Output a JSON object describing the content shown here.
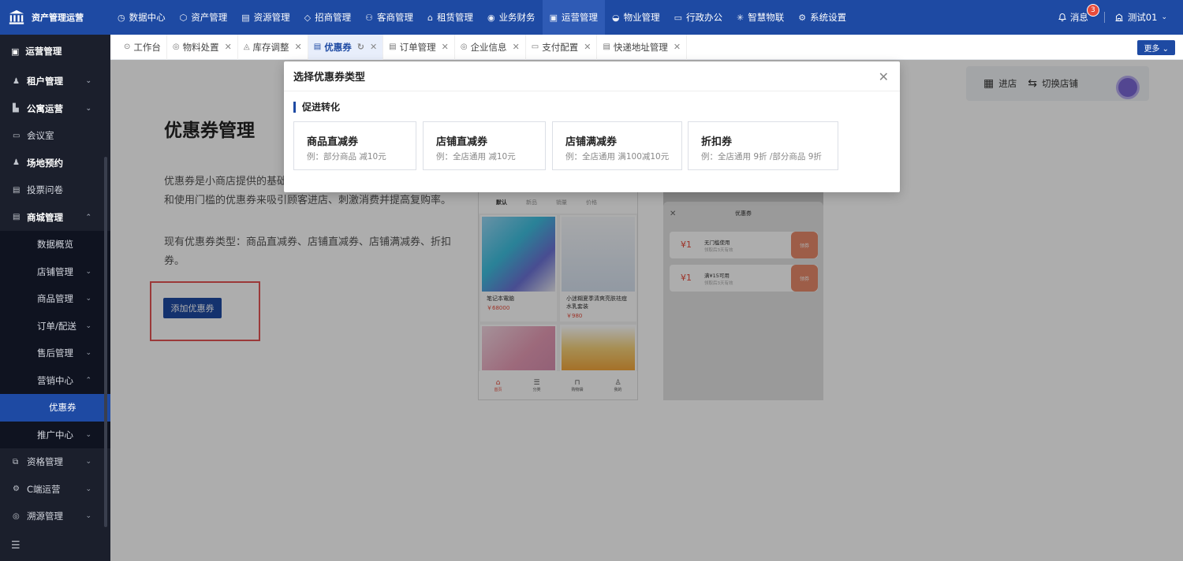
{
  "app": {
    "title": "资产管理运营"
  },
  "topnav": [
    {
      "label": "数据中心",
      "icon": "◷"
    },
    {
      "label": "资产管理",
      "icon": "⬡"
    },
    {
      "label": "资源管理",
      "icon": "▤"
    },
    {
      "label": "招商管理",
      "icon": "◇"
    },
    {
      "label": "客商管理",
      "icon": "⚇"
    },
    {
      "label": "租赁管理",
      "icon": "⌂"
    },
    {
      "label": "业务财务",
      "icon": "◉"
    },
    {
      "label": "运营管理",
      "icon": "▣",
      "active": true
    },
    {
      "label": "物业管理",
      "icon": "◒"
    },
    {
      "label": "行政办公",
      "icon": "▭"
    },
    {
      "label": "智慧物联",
      "icon": "✳"
    },
    {
      "label": "系统设置",
      "icon": "⚙"
    }
  ],
  "header_right": {
    "messages_label": "消息",
    "messages_count": "3",
    "user_name": "测试01"
  },
  "sidebar": {
    "title": "运营管理",
    "items": [
      {
        "label": "租户管理",
        "icon": "♟",
        "chevron": "⌄"
      },
      {
        "label": "公寓运营",
        "icon": "▙",
        "chevron": "⌄"
      },
      {
        "label": "会议室",
        "icon": "▭",
        "chevron": ""
      },
      {
        "label": "场地预约",
        "icon": "♟",
        "chevron": ""
      },
      {
        "label": "投票问卷",
        "icon": "▤",
        "chevron": ""
      },
      {
        "label": "商城管理",
        "icon": "▤",
        "chevron": "⌃"
      }
    ],
    "mall_sub": [
      {
        "label": "数据概览",
        "chevron": ""
      },
      {
        "label": "店铺管理",
        "chevron": "⌄"
      },
      {
        "label": "商品管理",
        "chevron": "⌄"
      },
      {
        "label": "订单/配送",
        "chevron": "⌄"
      },
      {
        "label": "售后管理",
        "chevron": "⌄"
      },
      {
        "label": "营销中心",
        "chevron": "⌃"
      }
    ],
    "marketing_sub": [
      {
        "label": "优惠券"
      }
    ],
    "after_sub": [
      {
        "label": "推广中心",
        "chevron": "⌄"
      }
    ],
    "bottom_items": [
      {
        "label": "资格管理",
        "icon": "⧉",
        "chevron": "⌄"
      },
      {
        "label": "C端运营",
        "icon": "⚙",
        "chevron": "⌄"
      },
      {
        "label": "溯源管理",
        "icon": "◎",
        "chevron": "⌄"
      }
    ]
  },
  "tabs": [
    {
      "label": "工作台",
      "icon": "⊙",
      "closable": false
    },
    {
      "label": "物料处置",
      "icon": "◎",
      "closable": true
    },
    {
      "label": "库存调整",
      "icon": "◬",
      "closable": true
    },
    {
      "label": "优惠券",
      "icon": "▤",
      "closable": true,
      "active": true
    },
    {
      "label": "订单管理",
      "icon": "▤",
      "closable": true
    },
    {
      "label": "企业信息",
      "icon": "◎",
      "closable": true
    },
    {
      "label": "支付配置",
      "icon": "▭",
      "closable": true
    },
    {
      "label": "快递地址管理",
      "icon": "▤",
      "closable": true
    }
  ],
  "more_label": "更多 ⌄",
  "corner": {
    "enter_store": "进店",
    "switch_store": "切换店铺"
  },
  "page": {
    "title": "优惠券管理",
    "desc1": "优惠券是小商店提供的基础营销工具，商家可通过设置不同面额和使用门槛的优惠券来吸引顾客进店、刺激消费并提高复购率。",
    "desc2": "现有优惠券类型：商品直减券、店铺直减券、店铺满减券、折扣券。",
    "add_button": "添加优惠券"
  },
  "phone1": {
    "tabs": [
      "默认",
      "新品",
      "销量",
      "价格"
    ],
    "products": [
      {
        "name": "笔记本電脑",
        "price": "￥68000"
      },
      {
        "name": "小迷糊夏季清爽亮肤祛痘水乳套装",
        "price": "￥980"
      },
      {
        "name": "",
        "price": ""
      },
      {
        "name": "",
        "price": ""
      }
    ],
    "bottom": [
      "首页",
      "分类",
      "购物袋",
      "我的"
    ]
  },
  "phone2": {
    "title": "优惠券",
    "coupons": [
      {
        "amount": "¥1",
        "title": "无门槛使用",
        "sub": "领取后3天有效",
        "button": "领券"
      },
      {
        "amount": "¥1",
        "title": "满¥15可用",
        "sub": "领取后3天有效",
        "button": "领券"
      }
    ]
  },
  "modal": {
    "title": "选择优惠券类型",
    "section": "促进转化",
    "types": [
      {
        "name": "商品直减券",
        "example": "例：部分商品 减10元"
      },
      {
        "name": "店铺直减券",
        "example": "例：全店通用 减10元"
      },
      {
        "name": "店铺满减券",
        "example": "例：全店通用 满100减10元"
      },
      {
        "name": "折扣券",
        "example": "例：全店通用 9折 /部分商品 9折"
      }
    ]
  }
}
